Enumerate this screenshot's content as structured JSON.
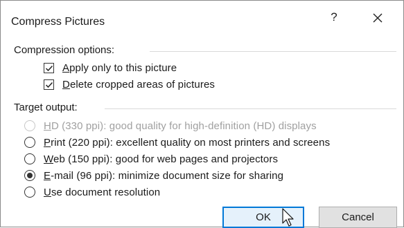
{
  "dialog": {
    "title": "Compress Pictures",
    "help_label": "?",
    "close_icon": "close-icon"
  },
  "compression": {
    "label": "Compression options:",
    "options": [
      {
        "mnemonic": "A",
        "rest": "pply only to this picture",
        "checked": true
      },
      {
        "mnemonic": "D",
        "rest": "elete cropped areas of pictures",
        "checked": true
      }
    ]
  },
  "target": {
    "label": "Target output:",
    "options": [
      {
        "mnemonic": "H",
        "rest": "D (330 ppi): good quality for high-definition (HD) displays",
        "selected": false,
        "disabled": true
      },
      {
        "mnemonic": "P",
        "rest": "rint (220 ppi): excellent quality on most printers and screens",
        "selected": false,
        "disabled": false
      },
      {
        "mnemonic": "W",
        "rest": "eb (150 ppi): good for web pages and projectors",
        "selected": false,
        "disabled": false
      },
      {
        "mnemonic": "E",
        "rest": "-mail (96 ppi): minimize document size for sharing",
        "selected": true,
        "disabled": false
      },
      {
        "mnemonic": "U",
        "rest": "se document resolution",
        "selected": false,
        "disabled": false
      }
    ]
  },
  "buttons": {
    "ok_label": "OK",
    "cancel_label": "Cancel"
  },
  "colors": {
    "accent": "#0078d7",
    "disabled_text": "#a0a0a0"
  }
}
